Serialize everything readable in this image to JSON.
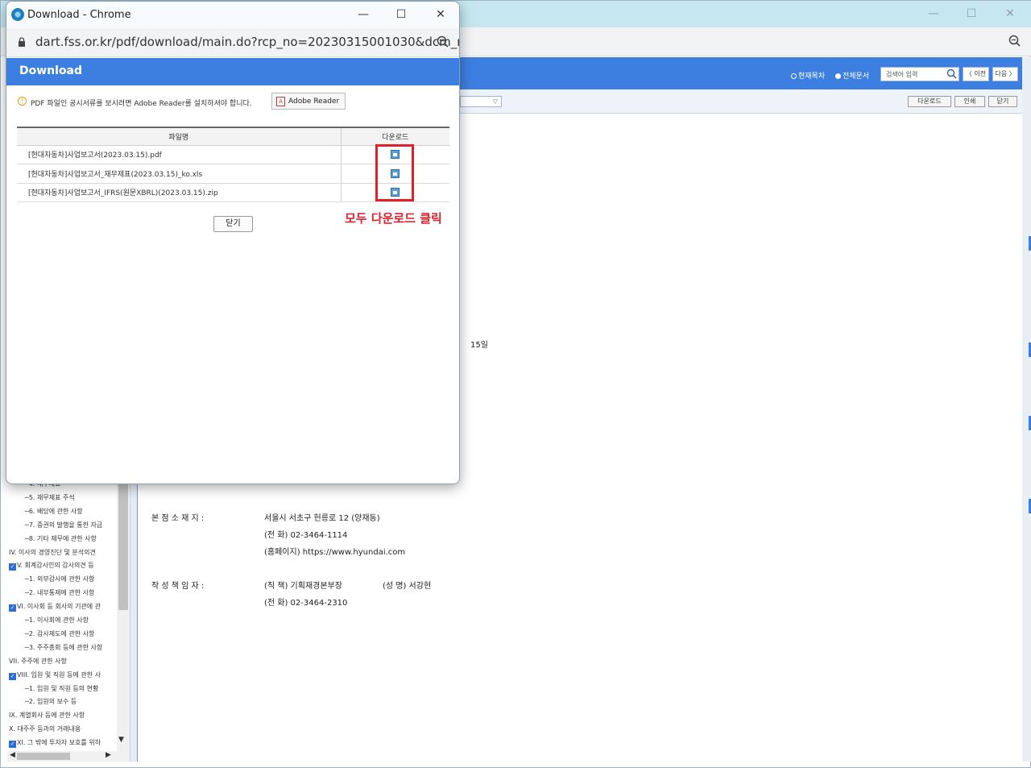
{
  "popup": {
    "window_title": "Download - Chrome",
    "url": "dart.fss.or.kr/pdf/download/main.do?rcp_no=20230315001030&dcm_n...",
    "header_title": "Download",
    "notice": "PDF 파일인 공시서류를 보시려면 Adobe Reader를 설치하셔야 합니다.",
    "adobe_button": "Adobe Reader",
    "table": {
      "headers": [
        "파일명",
        "다운로드"
      ],
      "rows": [
        {
          "name": "[현대자동차]사업보고서(2023.03.15).pdf"
        },
        {
          "name": "[현대자동차]사업보고서_재무제표(2023.03.15)_ko.xls"
        },
        {
          "name": "[현대자동차]사업보고서_IFRS(원문XBRL)(2023.03.15).zip"
        }
      ]
    },
    "annotation": "모두 다운로드 클릭",
    "close_button": "닫기"
  },
  "background": {
    "header": {
      "radio_current": "현재목차",
      "radio_all": "전체문서",
      "search_placeholder": "검색어 입력",
      "prev_button": "〈 이전",
      "next_button": "다음 〉"
    },
    "toolbar": {
      "download_button": "다운로드",
      "print_button": "인쇄",
      "close_button": "닫기"
    },
    "tree": [
      {
        "label": "─4. 재무제표",
        "checked": false
      },
      {
        "label": "─5. 재무제표 주석",
        "checked": false
      },
      {
        "label": "─6. 배당에 관한 사항",
        "checked": false
      },
      {
        "label": "─7. 증권의 발행을 통한 자금",
        "checked": false
      },
      {
        "label": "─8. 기타 재무에 관한 사항",
        "checked": false
      },
      {
        "label": "IV. 이사의 경영진단 및 분석의견",
        "checked": false
      },
      {
        "label": "V. 회계감사인의 감사의견 등",
        "checked": true
      },
      {
        "label": "─1. 외부감사에 관한 사항",
        "checked": false
      },
      {
        "label": "─2. 내부통제에 관한 사항",
        "checked": false
      },
      {
        "label": "VI. 이사회 등 회사의 기관에 관",
        "checked": true
      },
      {
        "label": "─1. 이사회에 관한 사항",
        "checked": false
      },
      {
        "label": "─2. 감사제도에 관한 사항",
        "checked": false
      },
      {
        "label": "─3. 주주총회 등에 관한 사항",
        "checked": false
      },
      {
        "label": "VII. 주주에 관한 사항",
        "checked": false
      },
      {
        "label": "VIII. 임원 및 직원 등에 관한 사",
        "checked": true
      },
      {
        "label": "─1. 임원 및 직원 등의 현황",
        "checked": false
      },
      {
        "label": "─2. 임원의 보수 등",
        "checked": false
      },
      {
        "label": "IX. 계열회사 등에 관한 사항",
        "checked": false
      },
      {
        "label": "X. 대주주 등과의 거래내용",
        "checked": false
      },
      {
        "label": "XI. 그 밖에 투자자 보호를 위하",
        "checked": true
      }
    ],
    "doc": {
      "date_fragment": "15일",
      "hq_label": "본 점 소 재 지 :",
      "hq_address": "서울시 서초구 헌릉로 12 (양재동)",
      "hq_phone": "(전  화) 02-3464-1114",
      "hq_homepage": "(홈페이지) https://www.hyundai.com",
      "author_label": "작 성 책 임 자 :",
      "author_title": "(직  책) 기획재경본부장",
      "author_name": "(성  명) 서강현",
      "author_phone": "(전  화)  02-3464-2310"
    }
  }
}
